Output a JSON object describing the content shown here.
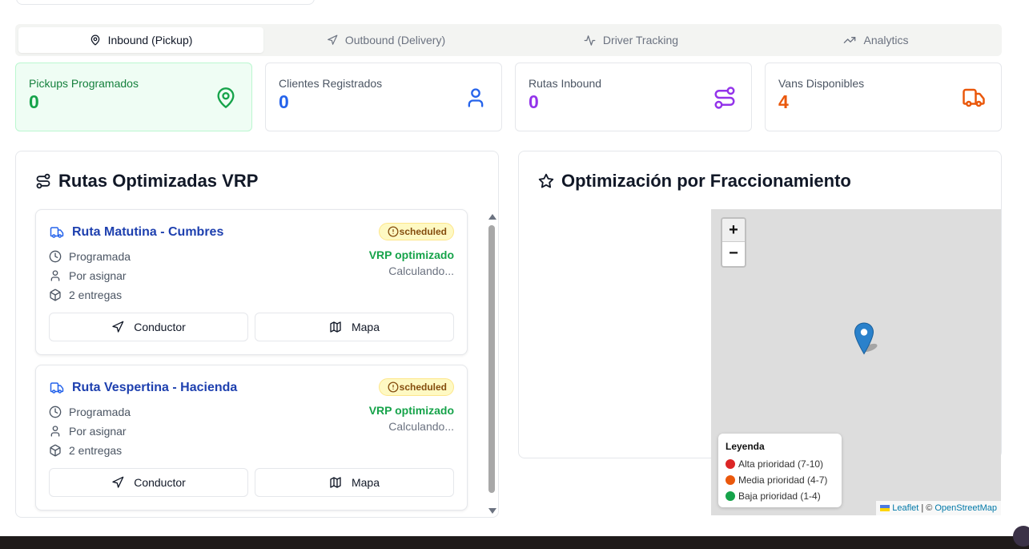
{
  "tabs": [
    {
      "label": "Inbound (Pickup)",
      "icon": "map-pin-icon",
      "active": true
    },
    {
      "label": "Outbound (Delivery)",
      "icon": "navigation-icon",
      "active": false
    },
    {
      "label": "Driver Tracking",
      "icon": "activity-icon",
      "active": false
    },
    {
      "label": "Analytics",
      "icon": "trending-up-icon",
      "active": false
    }
  ],
  "stats": [
    {
      "label": "Pickups Programados",
      "value": "0",
      "color": "#16a34a",
      "icon": "map-pin-icon"
    },
    {
      "label": "Clientes Registrados",
      "value": "0",
      "color": "#2563eb",
      "icon": "user-icon"
    },
    {
      "label": "Rutas Inbound",
      "value": "0",
      "color": "#9333ea",
      "icon": "route-icon"
    },
    {
      "label": "Vans Disponibles",
      "value": "4",
      "color": "#ea580c",
      "icon": "truck-icon"
    }
  ],
  "routes_panel": {
    "title": "Rutas Optimizadas VRP",
    "routes": [
      {
        "name": "Ruta Matutina - Cumbres",
        "status": "scheduled",
        "schedule": "Programada",
        "driver": "Por asignar",
        "deliveries": "2 entregas",
        "vrp": "VRP optimizado",
        "calc": "Calculando...",
        "driver_button": "Conductor",
        "map_button": "Mapa"
      },
      {
        "name": "Ruta Vespertina - Hacienda",
        "status": "scheduled",
        "schedule": "Programada",
        "driver": "Por asignar",
        "deliveries": "2 entregas",
        "vrp": "VRP optimizado",
        "calc": "Calculando...",
        "driver_button": "Conductor",
        "map_button": "Mapa"
      }
    ]
  },
  "optimization_panel": {
    "title": "Optimización por Fraccionamiento"
  },
  "map": {
    "zoom_in": "+",
    "zoom_out": "−",
    "legend": {
      "title": "Leyenda",
      "items": [
        {
          "label": "Alta prioridad (7-10)",
          "color": "#dc2626"
        },
        {
          "label": "Media prioridad (4-7)",
          "color": "#ea580c"
        },
        {
          "label": "Baja prioridad (1-4)",
          "color": "#16a34a"
        }
      ]
    },
    "attribution": {
      "leaflet": "Leaflet",
      "separator": "| ©",
      "osm": "OpenStreetMap"
    }
  }
}
